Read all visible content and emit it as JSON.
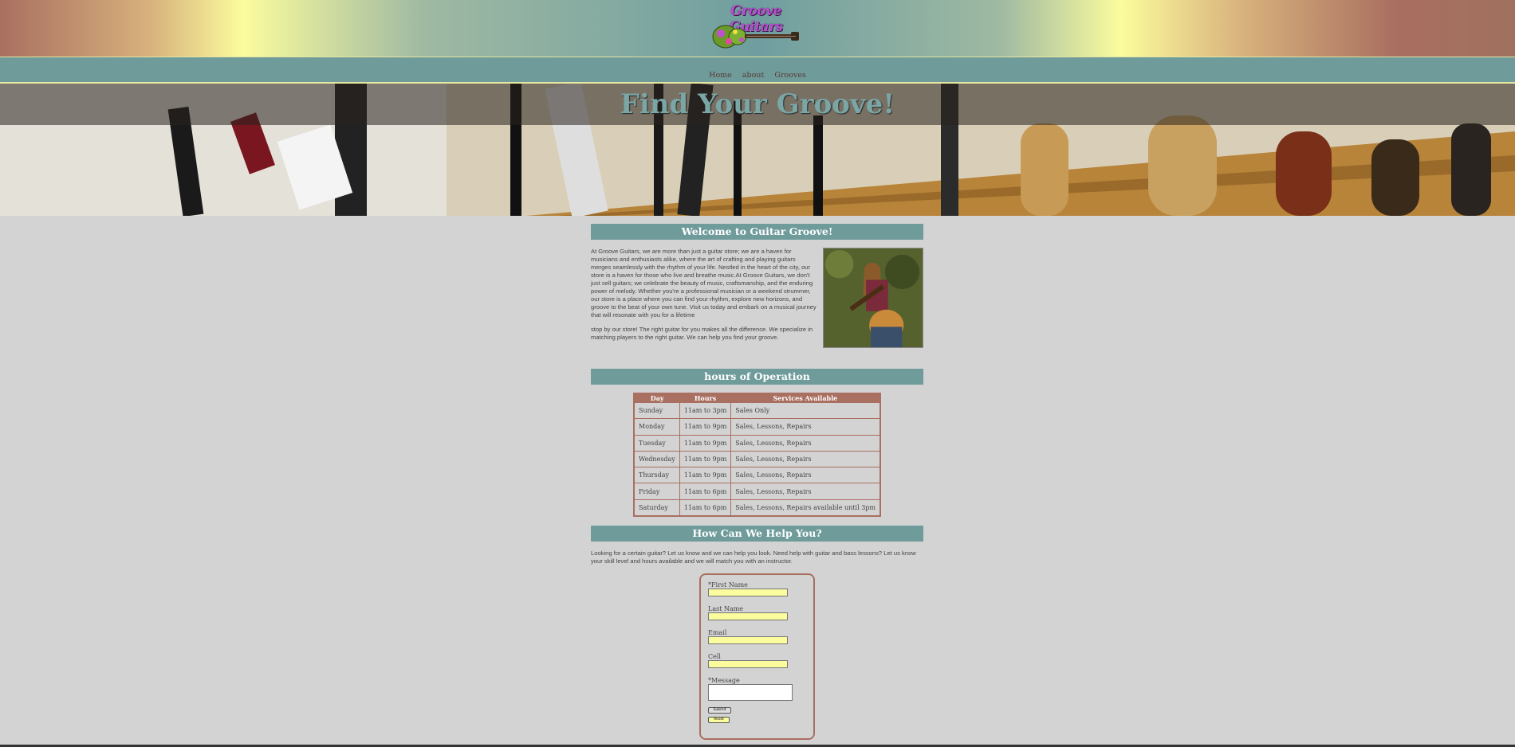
{
  "header": {
    "logo_text": "Groove Guitars"
  },
  "nav": {
    "items": [
      {
        "label": "Home"
      },
      {
        "label": "about"
      },
      {
        "label": "Grooves"
      }
    ]
  },
  "hero": {
    "title": "Find Your Groove!"
  },
  "welcome": {
    "heading": "Welcome to Guitar Groove!",
    "paragraph1": "At Groove Guitars, we are more than just a guitar store; we are a haven for musicians and enthusiasts alike, where the art of crafting and playing guitars merges seamlessly with the rhythm of your life. Nestled in the heart of the city, our store is a haven for those who live and breathe music.At Groove Guitars, we don't just sell guitars; we celebrate the beauty of music, craftsmanship, and the enduring power of melody. Whether you're a professional musician or a weekend strummer, our store is a place where you can find your rhythm, explore new horizons, and groove to the beat of your own tune. Visit us today and embark on a musical journey that will resonate with you for a lifetime",
    "paragraph2": "stop by our store! The right guitar for you makes all the difference. We specialize in matching players to the right guitar. We can help you find your groove."
  },
  "hours": {
    "heading": "hours of Operation",
    "columns": [
      "Day",
      "Hours",
      "Services Available"
    ],
    "rows": [
      [
        "Sunday",
        "11am to 3pm",
        "Sales Only"
      ],
      [
        "Monday",
        "11am to 9pm",
        "Sales, Lessons, Repairs"
      ],
      [
        "Tuesday",
        "11am to 9pm",
        "Sales, Lessons, Repairs"
      ],
      [
        "Wednesday",
        "11am to 9pm",
        "Sales, Lessons, Repairs"
      ],
      [
        "Thursday",
        "11am to 9pm",
        "Sales, Lessons, Repairs"
      ],
      [
        "Friday",
        "11am to 6pm",
        "Sales, Lessons, Repairs"
      ],
      [
        "Saturday",
        "11am to 6pm",
        "Sales, Lessons, Repairs available until 3pm"
      ]
    ]
  },
  "help": {
    "heading": "How Can We Help You?",
    "text": "Looking for a certain guitar? Let us know and we can help you look. Need help with guitar and bass lessons? Let us know your skill level and hours available and we will match you with an instructor."
  },
  "form": {
    "first_name_label": "*First Name",
    "last_name_label": "Last Name",
    "email_label": "Email",
    "cell_label": "Cell",
    "message_label": "*Message",
    "submit_label": "Submit",
    "reset_label": "Reset"
  },
  "colors": {
    "accent_teal": "#6f9b9b",
    "accent_rust": "#a96f60",
    "accent_yellow": "#fbfc9d",
    "logo_purple": "#b54fcc"
  }
}
